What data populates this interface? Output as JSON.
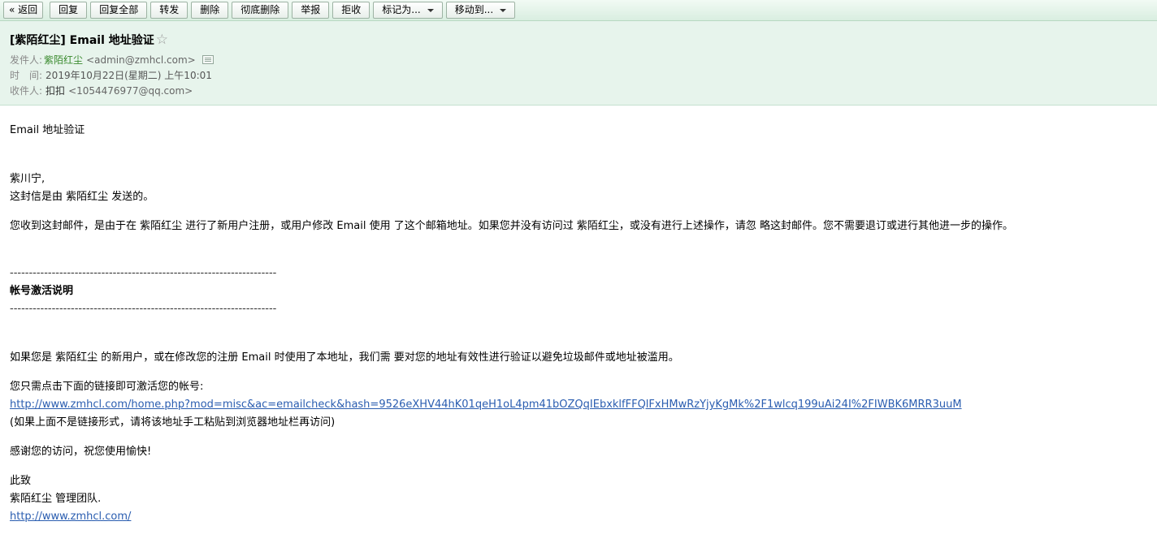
{
  "toolbar": {
    "back": "« 返回",
    "reply": "回复",
    "reply_all": "回复全部",
    "forward": "转发",
    "delete": "删除",
    "delete_forever": "彻底删除",
    "report": "举报",
    "reject": "拒收",
    "mark_as": "标记为...",
    "move_to": "移动到..."
  },
  "header": {
    "subject": "[紫陌红尘] Email 地址验证",
    "star": "☆",
    "from_label": "发件人:",
    "from_name": "紫陌红尘",
    "from_email": "<admin@zmhcl.com>",
    "time_label": "时　间:",
    "time_value": "2019年10月22日(星期二) 上午10:01",
    "to_label": "收件人:",
    "to_name": "扣扣",
    "to_email": "<1054476977@qq.com>"
  },
  "body": {
    "line1": "Email 地址验证",
    "greeting": "紫川宁,",
    "sent_by": "这封信是由 紫陌红尘 发送的。",
    "reason": "您收到这封邮件，是由于在 紫陌红尘 进行了新用户注册，或用户修改 Email 使用 了这个邮箱地址。如果您并没有访问过 紫陌红尘，或没有进行上述操作，请忽 略这封邮件。您不需要退订或进行其他进一步的操作。",
    "separator": "----------------------------------------------------------------------",
    "section_title": "帐号激活说明",
    "instruction": "如果您是 紫陌红尘 的新用户，或在修改您的注册 Email 时使用了本地址，我们需 要对您的地址有效性进行验证以避免垃圾邮件或地址被滥用。",
    "click_prompt": "您只需点击下面的链接即可激活您的帐号:",
    "activation_link": "http://www.zmhcl.com/home.php?mod=misc&ac=emailcheck&hash=9526eXHV44hK01qeH1oL4pm41bOZQqIEbxklfFFQlFxHMwRzYjyKgMk%2F1wlcq199uAi24I%2FIWBK6MRR3uuM",
    "copy_hint": "(如果上面不是链接形式，请将该地址手工粘贴到浏览器地址栏再访问)",
    "thanks": "感谢您的访问，祝您使用愉快!",
    "closing": "此致",
    "team": "紫陌红尘 管理团队.",
    "site_link": "http://www.zmhcl.com/"
  },
  "colors": {
    "header_bg": "#e7f4ec",
    "sender_name": "#3a8a2e",
    "link": "#2a5db0"
  }
}
